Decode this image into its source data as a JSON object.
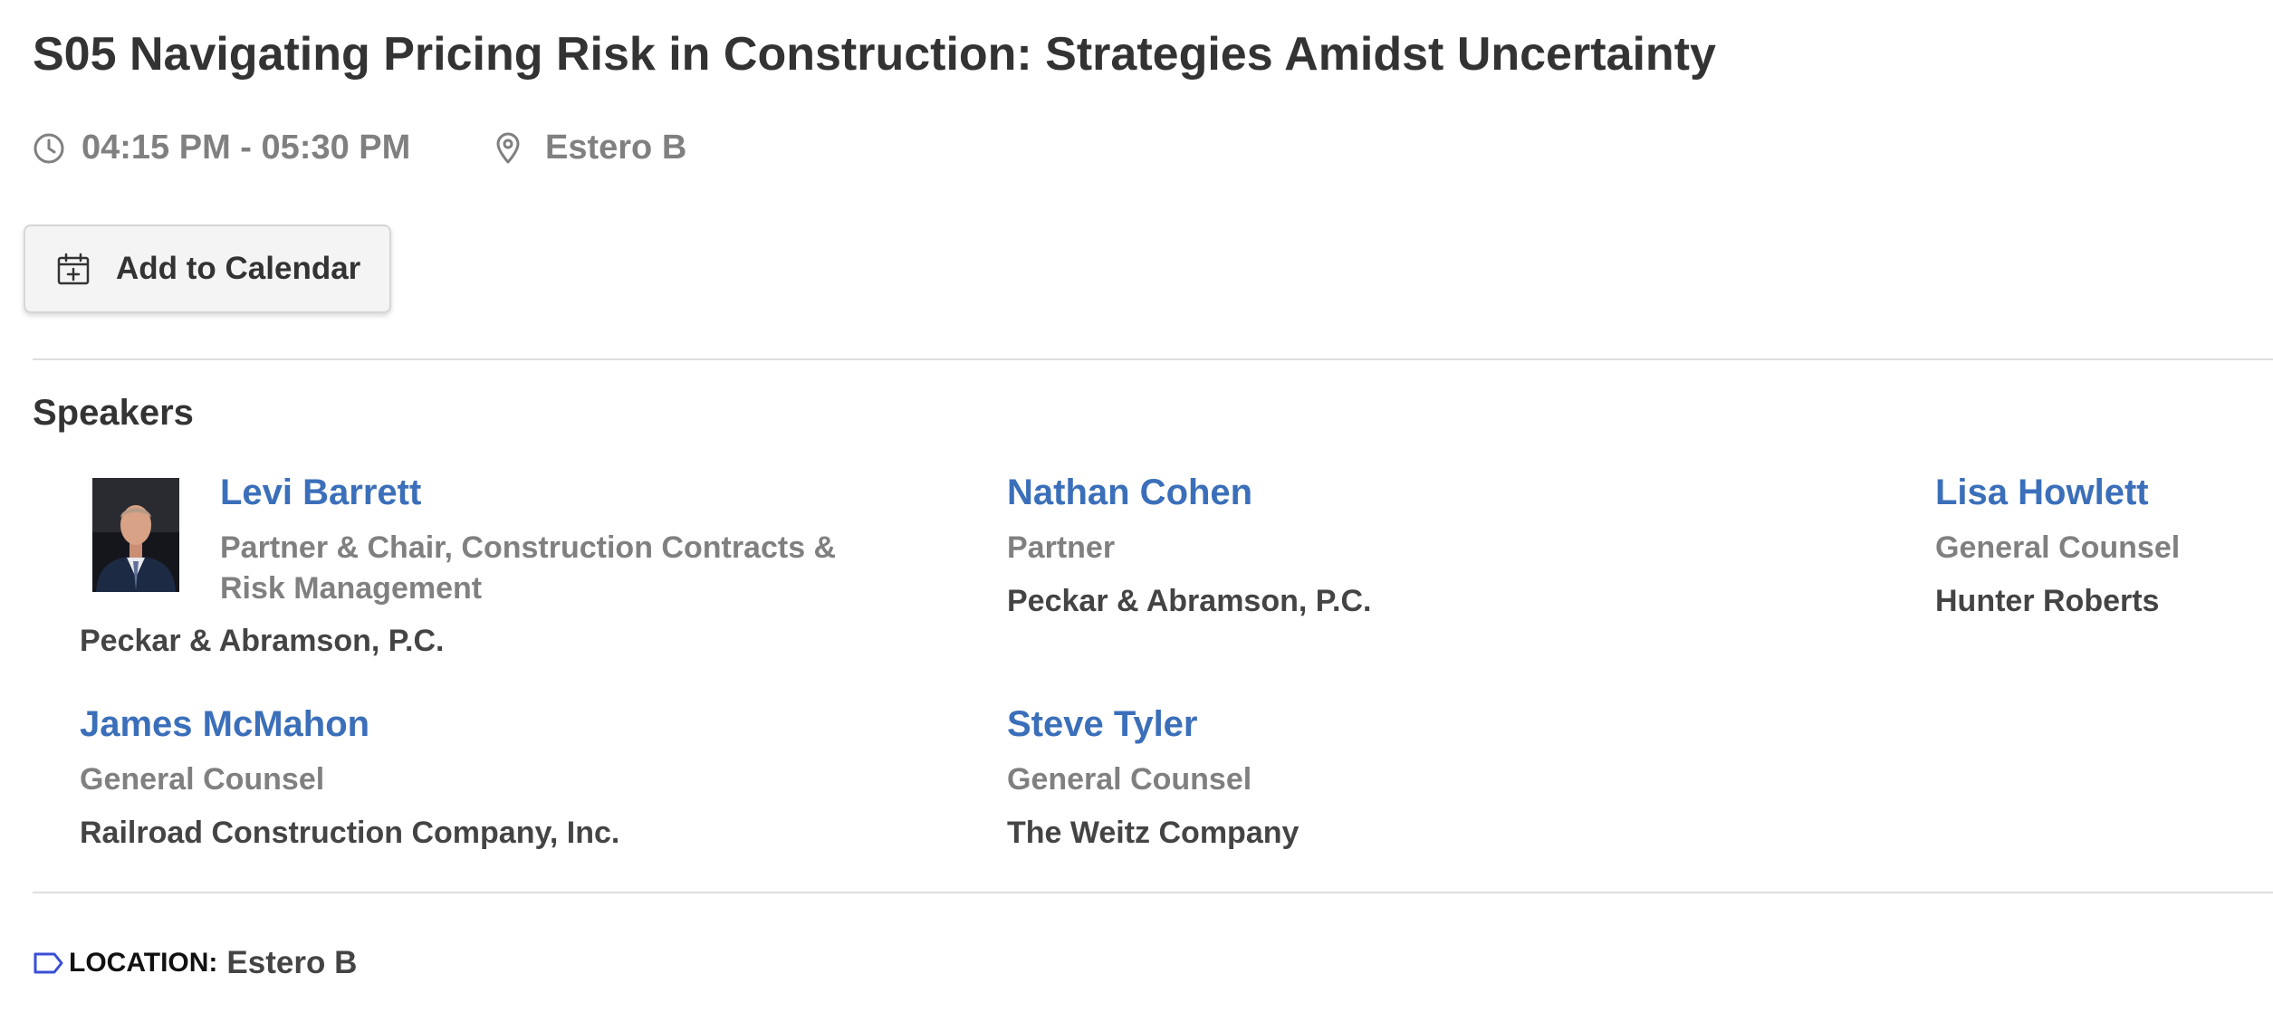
{
  "session": {
    "title": "S05 Navigating Pricing Risk in Construction: Strategies Amidst Uncertainty",
    "time": "04:15 PM - 05:30 PM",
    "location": "Estero B",
    "add_to_calendar_label": "Add to Calendar"
  },
  "icons": {
    "time": "clock-icon",
    "location": "map-pin-icon",
    "calendar": "calendar-add-icon",
    "location_tag": "tag-icon"
  },
  "speakers_section": {
    "heading": "Speakers",
    "speakers": [
      {
        "name": "Levi Barrett",
        "title": "Partner & Chair, Construction Contracts & Risk Management",
        "organization": "Peckar & Abramson, P.C.",
        "has_photo": true
      },
      {
        "name": "Nathan Cohen",
        "title": "Partner",
        "organization": "Peckar & Abramson, P.C."
      },
      {
        "name": "Lisa Howlett",
        "title": "General Counsel",
        "organization": "Hunter Roberts"
      },
      {
        "name": "James McMahon",
        "title": "General Counsel",
        "organization": "Railroad Construction Company, Inc."
      },
      {
        "name": "Steve Tyler",
        "title": "General Counsel",
        "organization": "The Weitz Company"
      }
    ]
  },
  "location_footer": {
    "label": "LOCATION:",
    "value": "Estero B"
  },
  "colors": {
    "link": "#3b6fba",
    "heading": "#333333",
    "muted": "#808080",
    "tag_icon": "#3a4fd6"
  }
}
